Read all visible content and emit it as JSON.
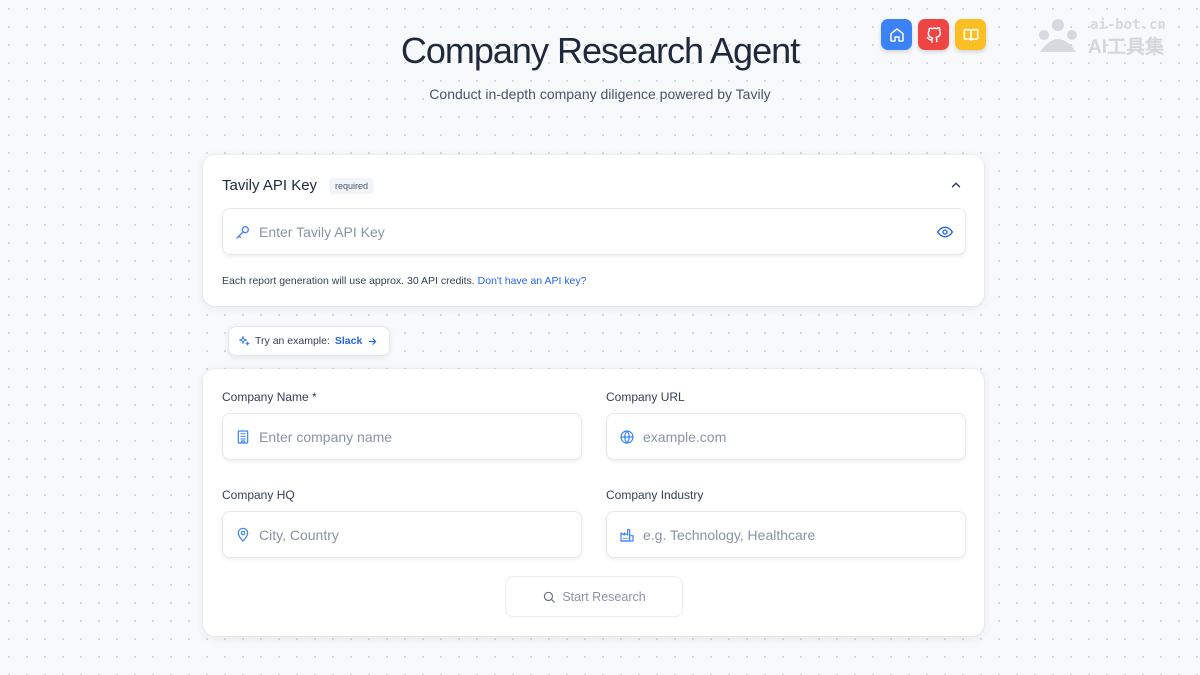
{
  "header": {
    "title": "Company Research Agent",
    "subtitle": "Conduct in-depth company diligence powered by Tavily"
  },
  "top_icons": [
    {
      "name": "home-icon",
      "color": "#3b82f6"
    },
    {
      "name": "github-icon",
      "color": "#ef4444"
    },
    {
      "name": "book-icon",
      "color": "#fbbf24"
    }
  ],
  "watermark": {
    "line1": "ai-bot.cn",
    "line2": "AI工具集"
  },
  "api_key": {
    "title": "Tavily API Key",
    "badge": "required",
    "placeholder": "Enter Tavily API Key",
    "note": "Each report generation will use approx. 30 API credits.",
    "link": "Don't have an API key?"
  },
  "example": {
    "prefix": "Try an example:",
    "company": "Slack"
  },
  "form": {
    "company_name": {
      "label": "Company Name *",
      "placeholder": "Enter company name"
    },
    "company_url": {
      "label": "Company URL",
      "placeholder": "example.com"
    },
    "company_hq": {
      "label": "Company HQ",
      "placeholder": "City, Country"
    },
    "company_industry": {
      "label": "Company Industry",
      "placeholder": "e.g. Technology, Healthcare"
    },
    "submit": "Start Research"
  },
  "colors": {
    "accent": "#2563eb",
    "icon": "#3b82f6"
  }
}
